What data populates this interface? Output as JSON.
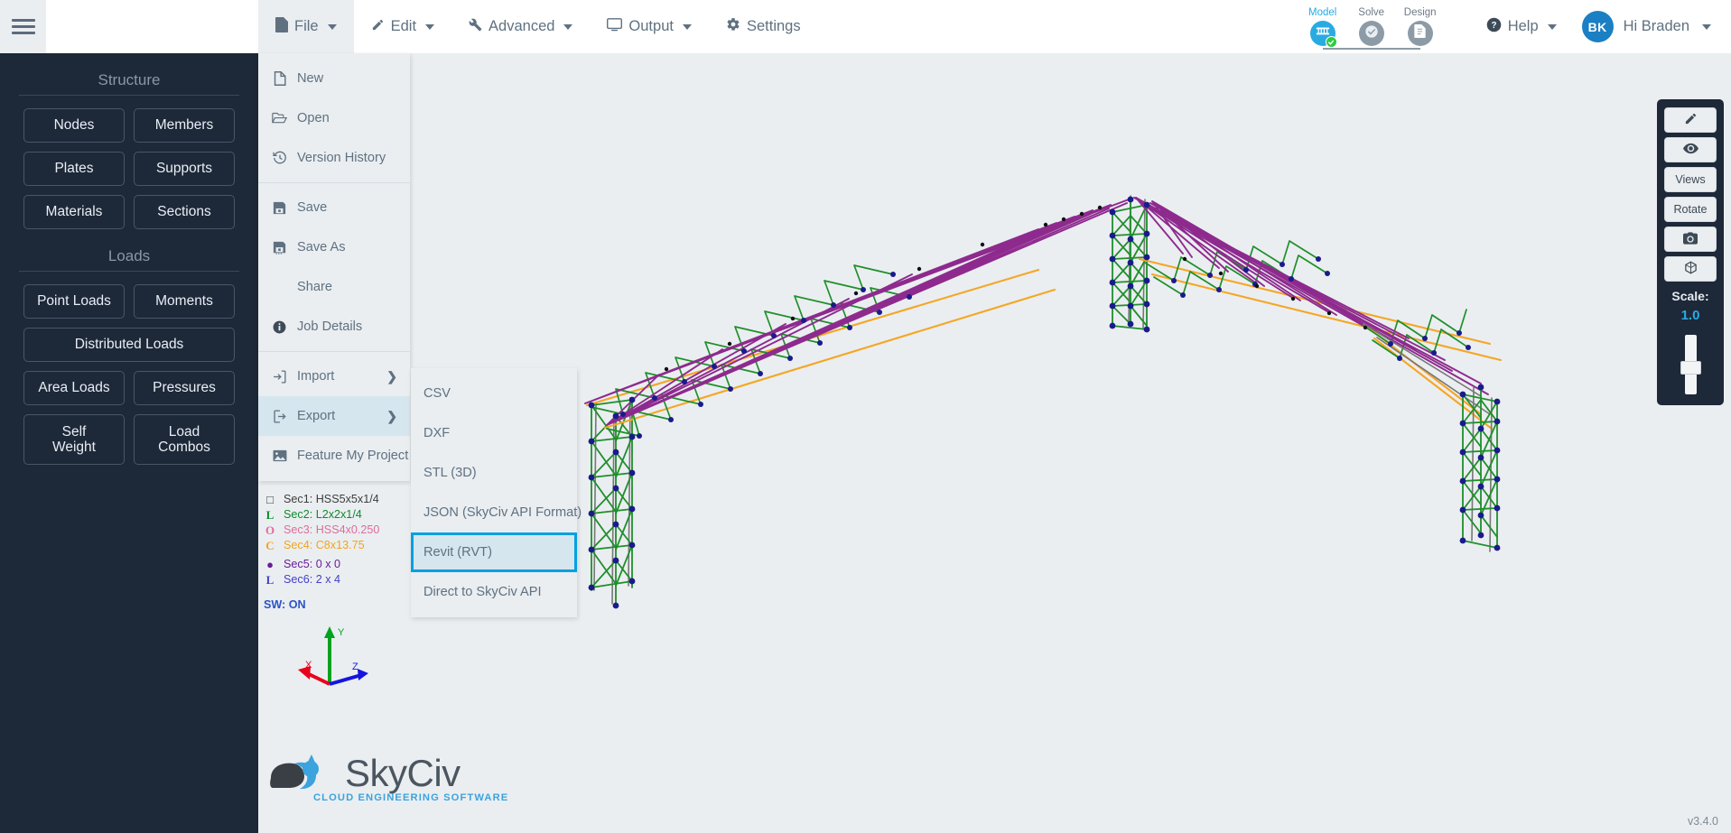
{
  "app": {
    "version": "v3.4.0"
  },
  "topbar": {
    "hamburger_label": "menu",
    "menus": [
      {
        "label": "File",
        "icon": "file-icon",
        "has_caret": true,
        "active": true
      },
      {
        "label": "Edit",
        "icon": "pencil-icon",
        "has_caret": true,
        "active": false
      },
      {
        "label": "Advanced",
        "icon": "wrench-icon",
        "has_caret": true,
        "active": false
      },
      {
        "label": "Output",
        "icon": "monitor-icon",
        "has_caret": true,
        "active": false
      },
      {
        "label": "Settings",
        "icon": "gear-icon",
        "has_caret": false,
        "active": false
      }
    ],
    "steps": [
      {
        "label": "Model",
        "state": "active",
        "icon": "bridge-icon",
        "badge": "check"
      },
      {
        "label": "Solve",
        "state": "inactive",
        "icon": "check-icon",
        "badge": null
      },
      {
        "label": "Design",
        "state": "inactive",
        "icon": "document-icon",
        "badge": null
      }
    ],
    "help_label": "Help",
    "user": {
      "initials": "BK",
      "greeting": "Hi Braden"
    },
    "accent_color": "#29abe2",
    "avatar_color": "#1b7fc4"
  },
  "sidebar": {
    "sections": [
      {
        "title": "Structure",
        "buttons": [
          {
            "label": "Nodes",
            "width": "half"
          },
          {
            "label": "Members",
            "width": "half"
          },
          {
            "label": "Plates",
            "width": "half"
          },
          {
            "label": "Supports",
            "width": "half"
          },
          {
            "label": "Materials",
            "width": "half"
          },
          {
            "label": "Sections",
            "width": "half"
          }
        ]
      },
      {
        "title": "Loads",
        "buttons": [
          {
            "label": "Point Loads",
            "width": "half"
          },
          {
            "label": "Moments",
            "width": "half"
          },
          {
            "label": "Distributed Loads",
            "width": "wide"
          },
          {
            "label": "Area Loads",
            "width": "half"
          },
          {
            "label": "Pressures",
            "width": "half"
          },
          {
            "label": "Self\nWeight",
            "width": "half",
            "tall": true
          },
          {
            "label": "Load\nCombos",
            "width": "half",
            "tall": true
          }
        ]
      }
    ]
  },
  "file_menu": {
    "items": [
      {
        "label": "New",
        "icon": "new-file-icon",
        "arrow": false,
        "separator_after": false
      },
      {
        "label": "Open",
        "icon": "open-folder-icon",
        "arrow": false,
        "separator_after": false
      },
      {
        "label": "Version History",
        "icon": "history-icon",
        "arrow": false,
        "separator_after": true
      },
      {
        "label": "Save",
        "icon": "save-icon",
        "arrow": false,
        "separator_after": false
      },
      {
        "label": "Save As",
        "icon": "save-as-icon",
        "arrow": false,
        "separator_after": false
      },
      {
        "label": "Share",
        "icon": null,
        "arrow": false,
        "separator_after": false
      },
      {
        "label": "Job Details",
        "icon": "info-icon",
        "arrow": false,
        "separator_after": true
      },
      {
        "label": "Import",
        "icon": "import-icon",
        "arrow": true,
        "separator_after": false
      },
      {
        "label": "Export",
        "icon": "export-icon",
        "arrow": true,
        "separator_after": false,
        "highlighted": true
      },
      {
        "label": "Feature My Project",
        "icon": "image-icon",
        "arrow": false,
        "separator_after": false
      }
    ]
  },
  "export_submenu": {
    "items": [
      {
        "label": "CSV",
        "selected": false
      },
      {
        "label": "DXF",
        "selected": false
      },
      {
        "label": "STL (3D)",
        "selected": false
      },
      {
        "label": "JSON (SkyCiv API Format)",
        "selected": false
      },
      {
        "label": "Revit (RVT)",
        "selected": true
      },
      {
        "label": "Direct to SkyCiv API",
        "selected": false
      }
    ],
    "selection_outline_color": "#00a0e1"
  },
  "section_legend": {
    "entries": [
      {
        "glyph": "□",
        "label": "Sec1: HSS5x5x1/4",
        "color": "#3d3d3d"
      },
      {
        "glyph": "L",
        "label": "Sec2: L2x2x1/4",
        "color": "#0f8a2a"
      },
      {
        "glyph": "O",
        "label": "Sec3: HSS4x0.250",
        "color": "#e06b9a"
      },
      {
        "glyph": "C",
        "label": "Sec4: C8x13.75",
        "color": "#f0a41e"
      },
      {
        "glyph": "●",
        "label": "Sec5: 0 x 0",
        "color": "#6a1b9a"
      },
      {
        "glyph": "L",
        "label": "Sec6: 2 x 4",
        "color": "#4540c4"
      }
    ],
    "self_weight_text": "SW: ON",
    "self_weight_color": "#2b53c8"
  },
  "axis_triad": {
    "x_label": "X",
    "x_color": "#e8001c",
    "y_label": "Y",
    "y_color": "#00a31e",
    "z_label": "Z",
    "z_color": "#1414e0"
  },
  "logo": {
    "name": "SkyCiv",
    "tagline": "CLOUD ENGINEERING SOFTWARE",
    "tagline_color": "#3ba3dd"
  },
  "right_toolbar": {
    "buttons": [
      {
        "label": null,
        "icon": "pencil-icon"
      },
      {
        "label": null,
        "icon": "eye-icon"
      },
      {
        "label": "Views",
        "icon": null
      },
      {
        "label": "Rotate",
        "icon": null
      },
      {
        "label": null,
        "icon": "camera-icon"
      },
      {
        "label": null,
        "icon": "cube-icon"
      }
    ],
    "scale_label": "Scale:",
    "scale_value": "1.0",
    "scale_color": "#29abe2"
  },
  "model": {
    "description": "3D truss bridge structure model",
    "member_colors": {
      "purple": "#8e2a8e",
      "green": "#1f8f2a",
      "orange": "#f5a623",
      "gray": "#777777",
      "node": "#1a1a8c"
    }
  }
}
